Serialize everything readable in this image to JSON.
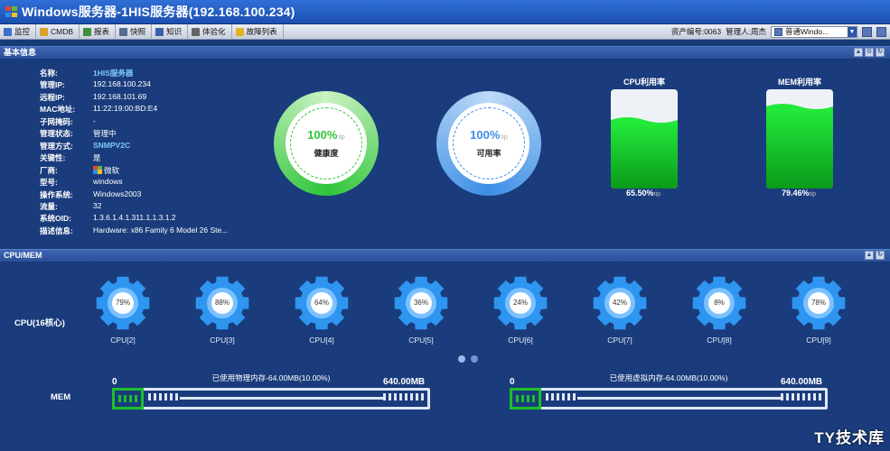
{
  "window": {
    "title": "Windows服务器-1HIS服务器(192.168.100.234)"
  },
  "toolbar": {
    "items": [
      {
        "label": "监控",
        "icon": "monitor-icon",
        "color": "#3c6fd1"
      },
      {
        "label": "CMDB",
        "icon": "cmdb-icon",
        "color": "#d8a12b"
      },
      {
        "label": "报表",
        "icon": "report-icon",
        "color": "#3f8f3f"
      },
      {
        "label": "快照",
        "icon": "snapshot-icon",
        "color": "#556b8f"
      },
      {
        "label": "知识",
        "icon": "knowledge-icon",
        "color": "#3a5fae"
      },
      {
        "label": "体验化",
        "icon": "experience-icon",
        "color": "#666666"
      },
      {
        "label": "故障列表",
        "icon": "warning-icon",
        "color": "#e2b321"
      }
    ],
    "asset_no": "资产编号:0063",
    "manager": "管理人:周杰",
    "view_select": "普通Windo..."
  },
  "basic_panel": {
    "title": "基本信息"
  },
  "info": [
    {
      "label": "名称:",
      "value": "1HIS服务器",
      "link": true
    },
    {
      "label": "管理IP:",
      "value": "192.168.100.234"
    },
    {
      "label": "远程IP:",
      "value": "192.168.101.69"
    },
    {
      "label": "MAC地址:",
      "value": "11:22:19:00:BD:E4"
    },
    {
      "label": "子网掩码:",
      "value": "-"
    },
    {
      "label": "管理状态:",
      "value": "管理中"
    },
    {
      "label": "管理方式:",
      "value": "SNMPV2C",
      "link": true
    },
    {
      "label": "关键性:",
      "value": "是"
    },
    {
      "label": "厂商:",
      "value": "微软",
      "logo": true
    },
    {
      "label": "型号:",
      "value": "windows"
    },
    {
      "label": "操作系统:",
      "value": "Windows2003"
    },
    {
      "label": "流量:",
      "value": "32"
    },
    {
      "label": "系统OID:",
      "value": "1.3.6.1.4.1.311.1.1.3.1.2"
    },
    {
      "label": "描述信息:",
      "value": "Hardware: x86 Family 6 Model 26 Ste..."
    }
  ],
  "health": {
    "value": "100%",
    "label": "健康度",
    "color": "#2fc53a"
  },
  "availability": {
    "value": "100%",
    "label": "可用率",
    "color": "#3d8ee6"
  },
  "cpu_usage": {
    "title": "CPU利用率",
    "value": "65.50%",
    "level": 0.655
  },
  "mem_usage": {
    "title": "MEM利用率",
    "value": "79.46%",
    "level": 0.7946
  },
  "cpumem_panel": {
    "title": "CPU/MEM"
  },
  "cpu_group_label": "CPU(16核心)",
  "cores": [
    {
      "name": "CPU[2]",
      "value": "79%"
    },
    {
      "name": "CPU[3]",
      "value": "88%"
    },
    {
      "name": "CPU[4]",
      "value": "64%"
    },
    {
      "name": "CPU[5]",
      "value": "36%"
    },
    {
      "name": "CPU[6]",
      "value": "24%"
    },
    {
      "name": "CPU[7]",
      "value": "42%"
    },
    {
      "name": "CPU[8]",
      "value": "8%"
    },
    {
      "name": "CPU[9]",
      "value": "78%"
    }
  ],
  "mem_label": "MEM",
  "physical_mem": {
    "min": "0",
    "max": "640.00MB",
    "caption": "已使用物理内存-64.00MB(10.00%)",
    "fraction": 0.1
  },
  "virtual_mem": {
    "min": "0",
    "max": "640.00MB",
    "caption": "已使用虚拟内存-64.00MB(10.00%)",
    "fraction": 0.1
  },
  "watermark": "TY技术库"
}
